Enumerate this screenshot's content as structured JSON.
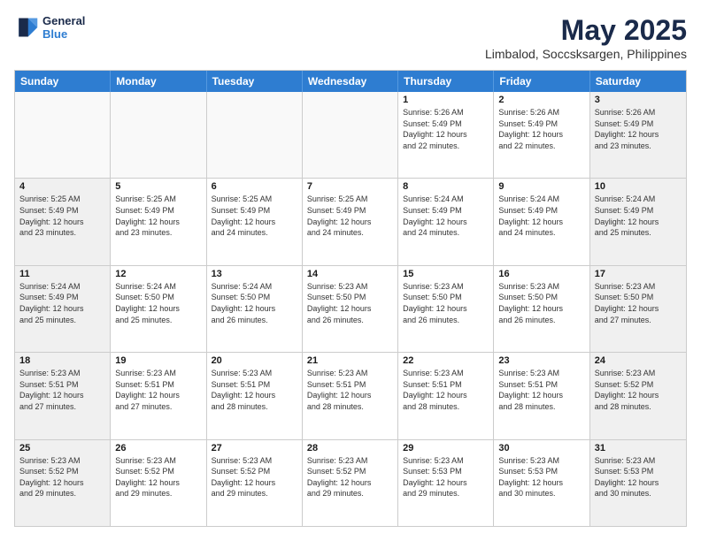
{
  "header": {
    "logo": {
      "line1": "General",
      "line2": "Blue"
    },
    "month_year": "May 2025",
    "location": "Limbalod, Soccsksargen, Philippines"
  },
  "days_of_week": [
    "Sunday",
    "Monday",
    "Tuesday",
    "Wednesday",
    "Thursday",
    "Friday",
    "Saturday"
  ],
  "weeks": [
    [
      {
        "day": "",
        "info": ""
      },
      {
        "day": "",
        "info": ""
      },
      {
        "day": "",
        "info": ""
      },
      {
        "day": "",
        "info": ""
      },
      {
        "day": "1",
        "info": "Sunrise: 5:26 AM\nSunset: 5:49 PM\nDaylight: 12 hours\nand 22 minutes."
      },
      {
        "day": "2",
        "info": "Sunrise: 5:26 AM\nSunset: 5:49 PM\nDaylight: 12 hours\nand 22 minutes."
      },
      {
        "day": "3",
        "info": "Sunrise: 5:26 AM\nSunset: 5:49 PM\nDaylight: 12 hours\nand 23 minutes."
      }
    ],
    [
      {
        "day": "4",
        "info": "Sunrise: 5:25 AM\nSunset: 5:49 PM\nDaylight: 12 hours\nand 23 minutes."
      },
      {
        "day": "5",
        "info": "Sunrise: 5:25 AM\nSunset: 5:49 PM\nDaylight: 12 hours\nand 23 minutes."
      },
      {
        "day": "6",
        "info": "Sunrise: 5:25 AM\nSunset: 5:49 PM\nDaylight: 12 hours\nand 24 minutes."
      },
      {
        "day": "7",
        "info": "Sunrise: 5:25 AM\nSunset: 5:49 PM\nDaylight: 12 hours\nand 24 minutes."
      },
      {
        "day": "8",
        "info": "Sunrise: 5:24 AM\nSunset: 5:49 PM\nDaylight: 12 hours\nand 24 minutes."
      },
      {
        "day": "9",
        "info": "Sunrise: 5:24 AM\nSunset: 5:49 PM\nDaylight: 12 hours\nand 24 minutes."
      },
      {
        "day": "10",
        "info": "Sunrise: 5:24 AM\nSunset: 5:49 PM\nDaylight: 12 hours\nand 25 minutes."
      }
    ],
    [
      {
        "day": "11",
        "info": "Sunrise: 5:24 AM\nSunset: 5:49 PM\nDaylight: 12 hours\nand 25 minutes."
      },
      {
        "day": "12",
        "info": "Sunrise: 5:24 AM\nSunset: 5:50 PM\nDaylight: 12 hours\nand 25 minutes."
      },
      {
        "day": "13",
        "info": "Sunrise: 5:24 AM\nSunset: 5:50 PM\nDaylight: 12 hours\nand 26 minutes."
      },
      {
        "day": "14",
        "info": "Sunrise: 5:23 AM\nSunset: 5:50 PM\nDaylight: 12 hours\nand 26 minutes."
      },
      {
        "day": "15",
        "info": "Sunrise: 5:23 AM\nSunset: 5:50 PM\nDaylight: 12 hours\nand 26 minutes."
      },
      {
        "day": "16",
        "info": "Sunrise: 5:23 AM\nSunset: 5:50 PM\nDaylight: 12 hours\nand 26 minutes."
      },
      {
        "day": "17",
        "info": "Sunrise: 5:23 AM\nSunset: 5:50 PM\nDaylight: 12 hours\nand 27 minutes."
      }
    ],
    [
      {
        "day": "18",
        "info": "Sunrise: 5:23 AM\nSunset: 5:51 PM\nDaylight: 12 hours\nand 27 minutes."
      },
      {
        "day": "19",
        "info": "Sunrise: 5:23 AM\nSunset: 5:51 PM\nDaylight: 12 hours\nand 27 minutes."
      },
      {
        "day": "20",
        "info": "Sunrise: 5:23 AM\nSunset: 5:51 PM\nDaylight: 12 hours\nand 28 minutes."
      },
      {
        "day": "21",
        "info": "Sunrise: 5:23 AM\nSunset: 5:51 PM\nDaylight: 12 hours\nand 28 minutes."
      },
      {
        "day": "22",
        "info": "Sunrise: 5:23 AM\nSunset: 5:51 PM\nDaylight: 12 hours\nand 28 minutes."
      },
      {
        "day": "23",
        "info": "Sunrise: 5:23 AM\nSunset: 5:51 PM\nDaylight: 12 hours\nand 28 minutes."
      },
      {
        "day": "24",
        "info": "Sunrise: 5:23 AM\nSunset: 5:52 PM\nDaylight: 12 hours\nand 28 minutes."
      }
    ],
    [
      {
        "day": "25",
        "info": "Sunrise: 5:23 AM\nSunset: 5:52 PM\nDaylight: 12 hours\nand 29 minutes."
      },
      {
        "day": "26",
        "info": "Sunrise: 5:23 AM\nSunset: 5:52 PM\nDaylight: 12 hours\nand 29 minutes."
      },
      {
        "day": "27",
        "info": "Sunrise: 5:23 AM\nSunset: 5:52 PM\nDaylight: 12 hours\nand 29 minutes."
      },
      {
        "day": "28",
        "info": "Sunrise: 5:23 AM\nSunset: 5:52 PM\nDaylight: 12 hours\nand 29 minutes."
      },
      {
        "day": "29",
        "info": "Sunrise: 5:23 AM\nSunset: 5:53 PM\nDaylight: 12 hours\nand 29 minutes."
      },
      {
        "day": "30",
        "info": "Sunrise: 5:23 AM\nSunset: 5:53 PM\nDaylight: 12 hours\nand 30 minutes."
      },
      {
        "day": "31",
        "info": "Sunrise: 5:23 AM\nSunset: 5:53 PM\nDaylight: 12 hours\nand 30 minutes."
      }
    ]
  ]
}
